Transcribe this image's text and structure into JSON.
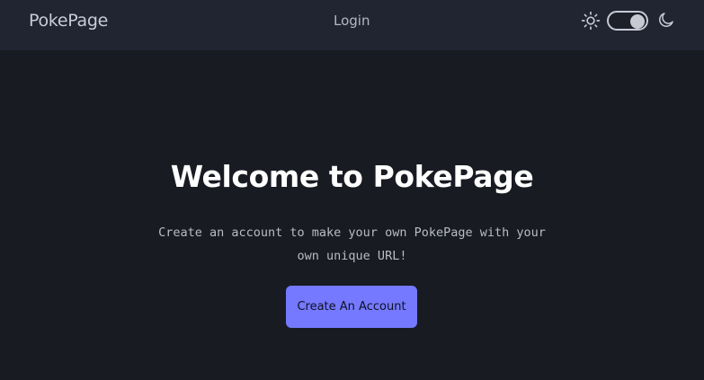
{
  "navbar": {
    "brand": "PokePage",
    "login_label": "Login",
    "theme_toggle": {
      "light_icon": "sun-icon",
      "dark_icon": "moon-icon",
      "state": "dark"
    }
  },
  "hero": {
    "title": "Welcome to PokePage",
    "text": "Create an account to make your own PokePage with your own unique URL!",
    "cta_label": "Create An Account"
  },
  "colors": {
    "page_background": "#181b22",
    "navbar_background": "#212431",
    "accent": "#7479ff"
  }
}
